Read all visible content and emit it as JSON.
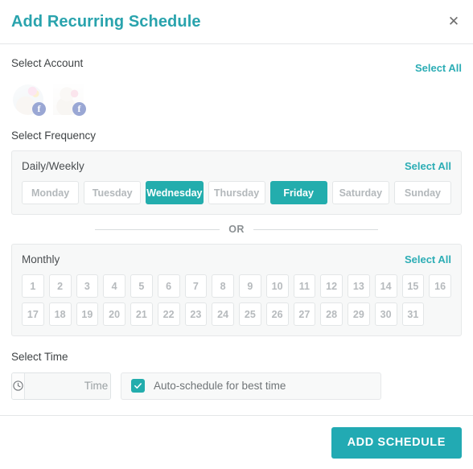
{
  "modal": {
    "title": "Add Recurring Schedule",
    "close_icon": "close-icon"
  },
  "accent_color": "#23adad",
  "link_color": "#2cadb5",
  "account_section": {
    "label": "Select Account",
    "select_all": "Select All",
    "accounts": [
      {
        "name": "account-1",
        "network": "facebook",
        "network_glyph": "f",
        "selected": false
      },
      {
        "name": "account-2",
        "network": "facebook",
        "network_glyph": "f",
        "selected": false
      }
    ]
  },
  "frequency_section": {
    "label": "Select Frequency",
    "weekly": {
      "title": "Daily/Weekly",
      "select_all": "Select All",
      "days": [
        {
          "label": "Monday",
          "selected": false
        },
        {
          "label": "Tuesday",
          "selected": false
        },
        {
          "label": "Wednesday",
          "selected": true
        },
        {
          "label": "Thursday",
          "selected": false
        },
        {
          "label": "Friday",
          "selected": true
        },
        {
          "label": "Saturday",
          "selected": false
        },
        {
          "label": "Sunday",
          "selected": false
        }
      ]
    },
    "divider_text": "OR",
    "monthly": {
      "title": "Monthly",
      "select_all": "Select All",
      "days": [
        {
          "label": "1",
          "selected": false
        },
        {
          "label": "2",
          "selected": false
        },
        {
          "label": "3",
          "selected": false
        },
        {
          "label": "4",
          "selected": false
        },
        {
          "label": "5",
          "selected": false
        },
        {
          "label": "6",
          "selected": false
        },
        {
          "label": "7",
          "selected": false
        },
        {
          "label": "8",
          "selected": false
        },
        {
          "label": "9",
          "selected": false
        },
        {
          "label": "10",
          "selected": false
        },
        {
          "label": "11",
          "selected": false
        },
        {
          "label": "12",
          "selected": false
        },
        {
          "label": "13",
          "selected": false
        },
        {
          "label": "14",
          "selected": false
        },
        {
          "label": "15",
          "selected": false
        },
        {
          "label": "16",
          "selected": false
        },
        {
          "label": "17",
          "selected": false
        },
        {
          "label": "18",
          "selected": false
        },
        {
          "label": "19",
          "selected": false
        },
        {
          "label": "20",
          "selected": false
        },
        {
          "label": "21",
          "selected": false
        },
        {
          "label": "22",
          "selected": false
        },
        {
          "label": "23",
          "selected": false
        },
        {
          "label": "24",
          "selected": false
        },
        {
          "label": "25",
          "selected": false
        },
        {
          "label": "26",
          "selected": false
        },
        {
          "label": "27",
          "selected": false
        },
        {
          "label": "28",
          "selected": false
        },
        {
          "label": "29",
          "selected": false
        },
        {
          "label": "30",
          "selected": false
        },
        {
          "label": "31",
          "selected": false
        }
      ]
    }
  },
  "time_section": {
    "label": "Select Time",
    "time_icon": "clock-icon",
    "time_value": "",
    "time_placeholder": "Time",
    "auto_schedule": {
      "label": "Auto-schedule for best time",
      "checked": true,
      "check_glyph": "✔"
    }
  },
  "footer": {
    "submit_label": "ADD SCHEDULE"
  }
}
